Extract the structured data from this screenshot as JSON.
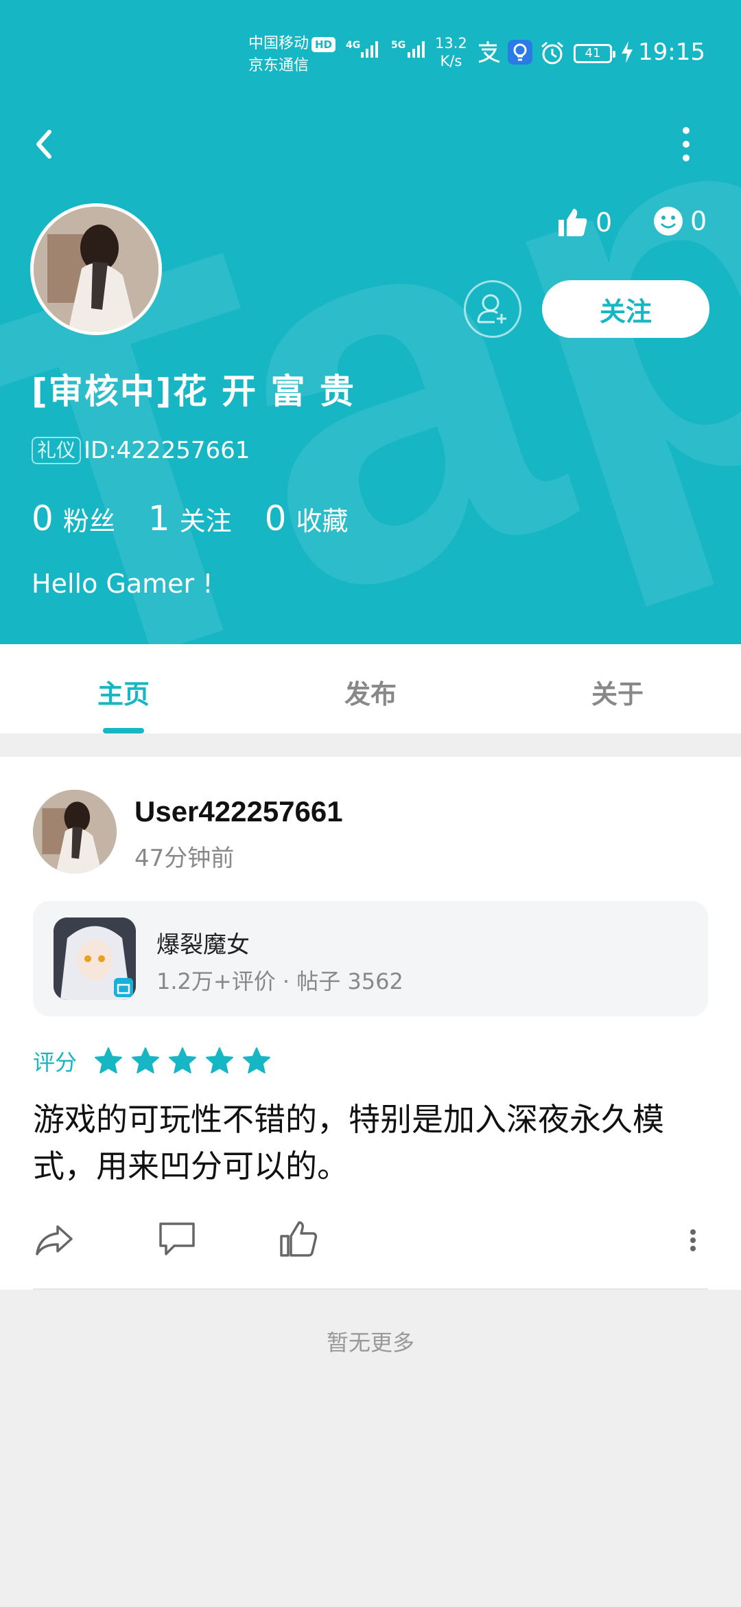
{
  "status_bar": {
    "carrier_line1": "中国移动",
    "carrier_badge": "HD",
    "carrier_line2": "京东通信",
    "signal1": "4G",
    "signal2": "5G",
    "speed_value": "13.2",
    "speed_unit": "K/s",
    "battery": "41",
    "time": "19:15"
  },
  "profile": {
    "likes": "0",
    "smiles": "0",
    "follow_label": "关注",
    "username": "[审核中]花 开 富 贵",
    "tag": "礼仪",
    "id_text": "ID:422257661",
    "fans_count": "0",
    "fans_label": "粉丝",
    "following_count": "1",
    "following_label": "关注",
    "fav_count": "0",
    "fav_label": "收藏",
    "bio": "Hello Gamer !"
  },
  "tabs": [
    {
      "label": "主页"
    },
    {
      "label": "发布"
    },
    {
      "label": "关于"
    }
  ],
  "post": {
    "user": "User422257661",
    "time": "47分钟前",
    "game_name": "爆裂魔女",
    "game_meta": "1.2万+评价 · 帖子 3562",
    "rating_label": "评分",
    "stars": 5,
    "review": "游戏的可玩性不错的，特别是加入深夜永久模式，用来凹分可以的。"
  },
  "footer": {
    "no_more": "暂无更多"
  },
  "colors": {
    "accent": "#16b6c4"
  }
}
